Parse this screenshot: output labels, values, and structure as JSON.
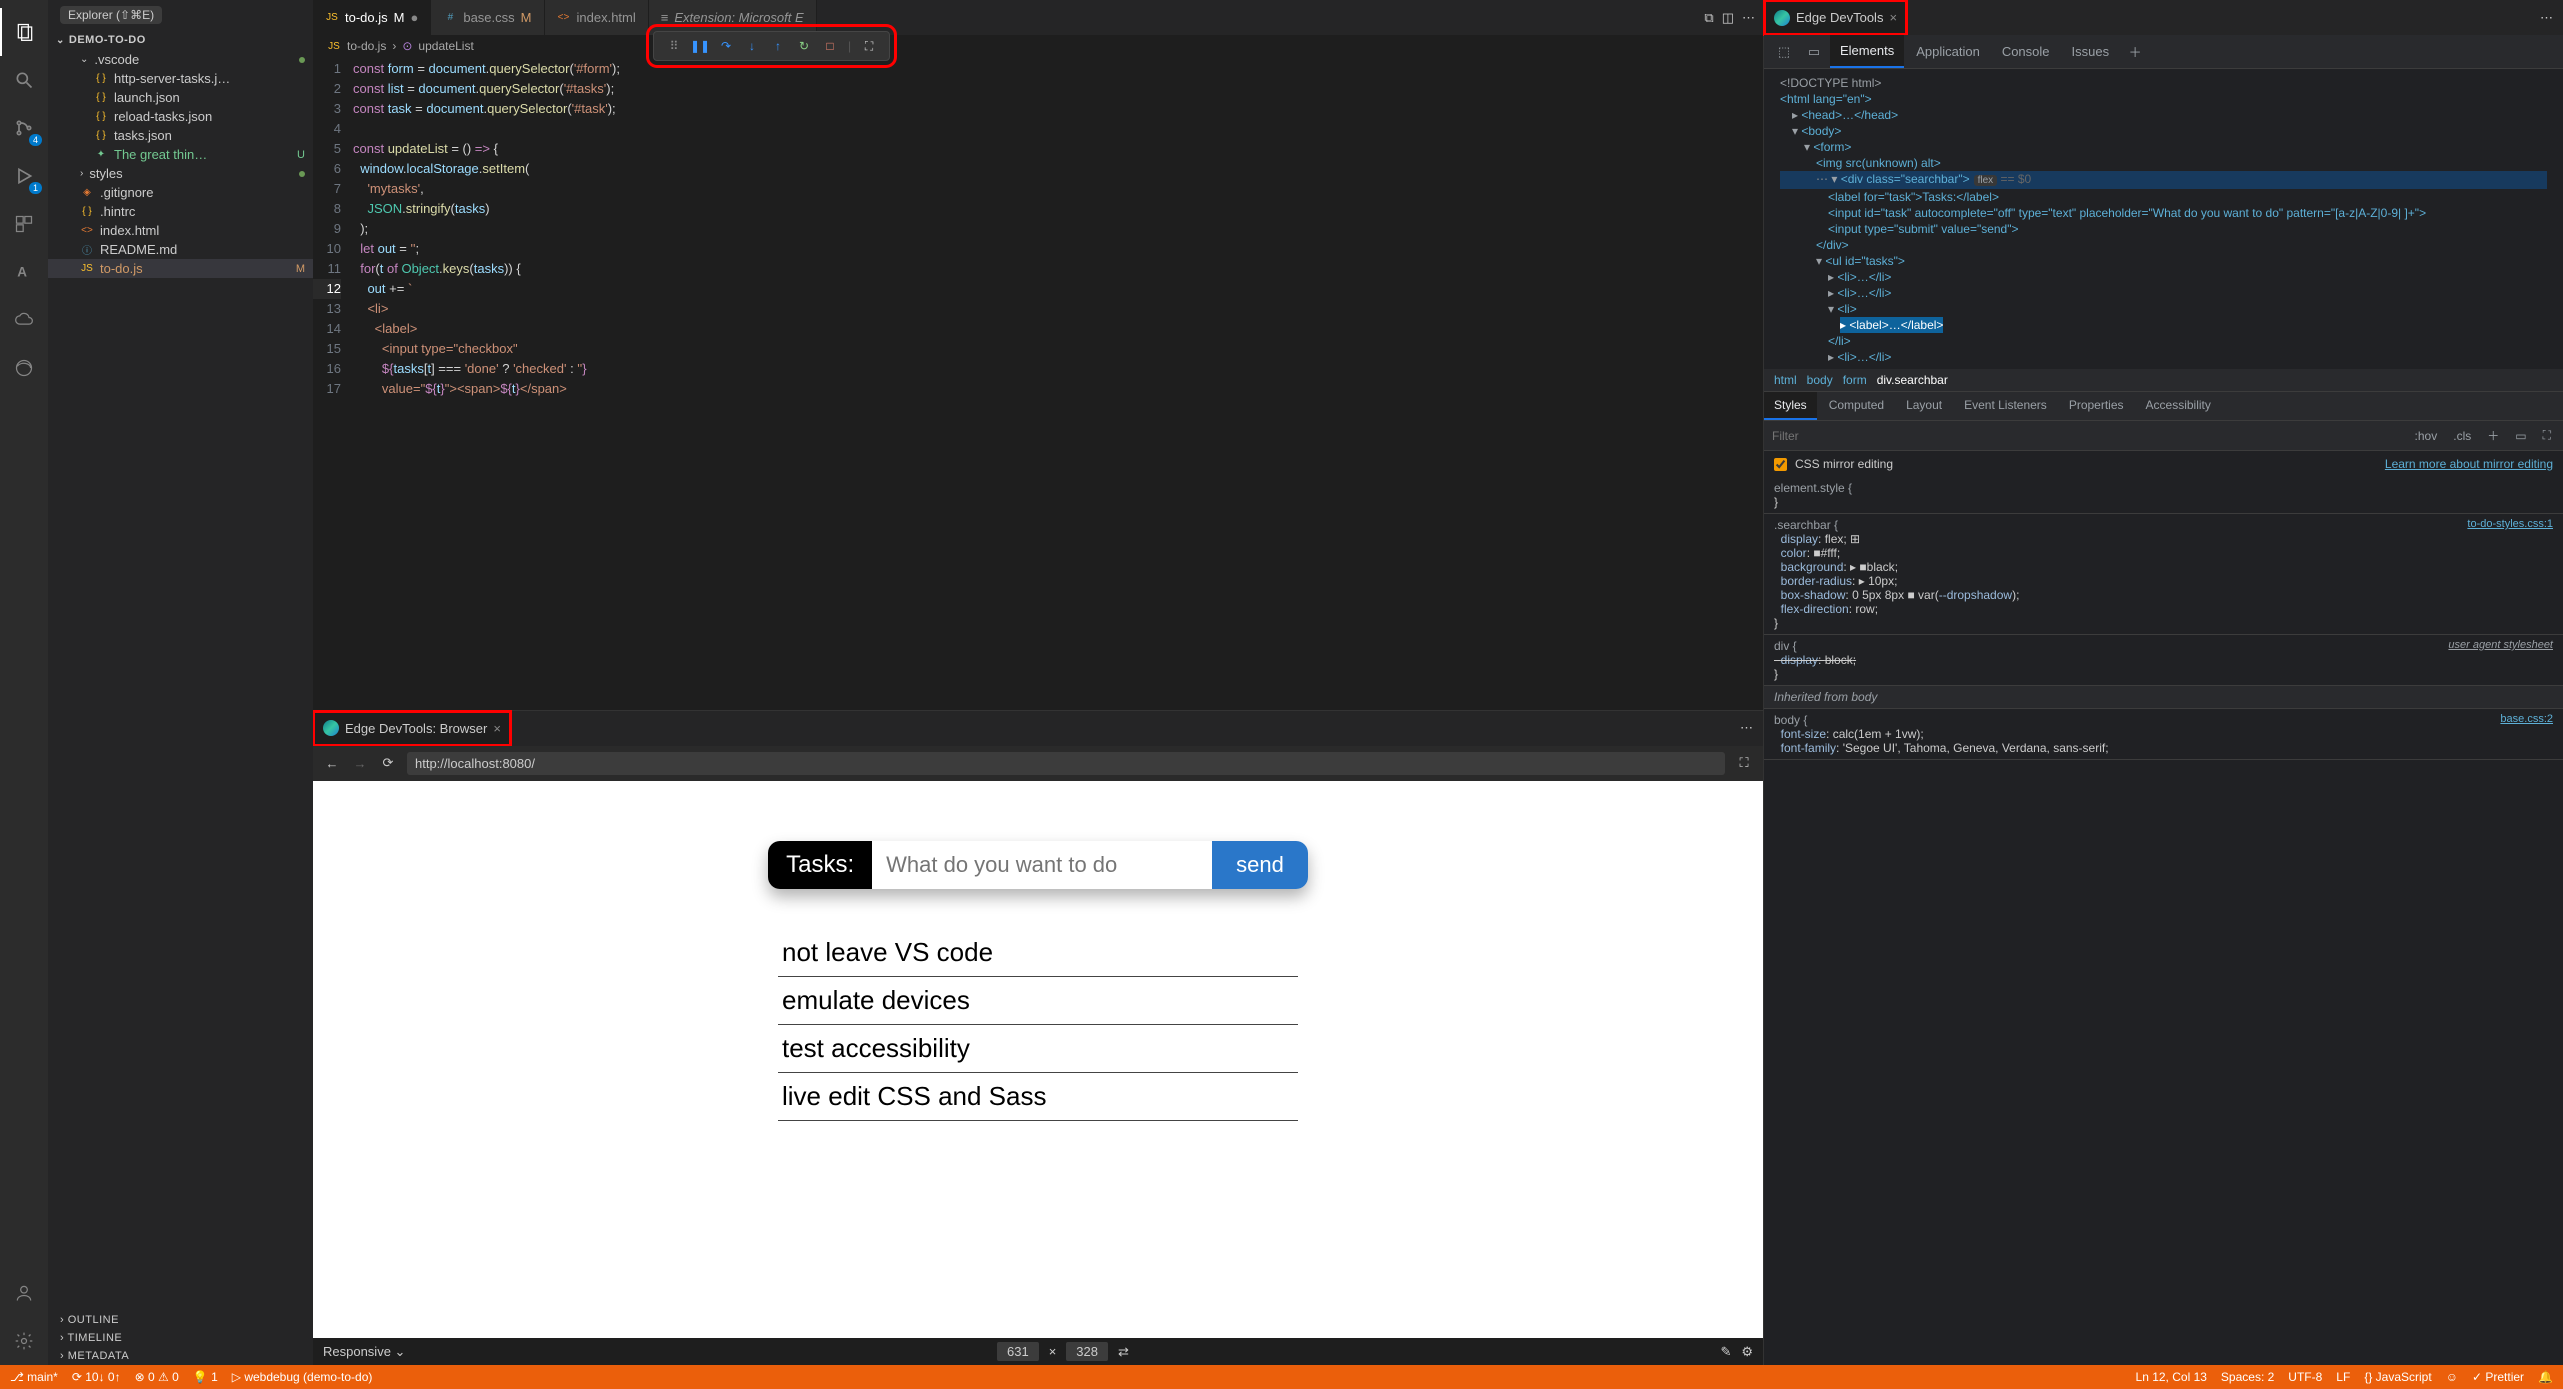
{
  "sidebar": {
    "explorer_label": "Explorer (⇧⌘E)",
    "project": "DEMO-TO-DO",
    "folder_vscode": ".vscode",
    "files": {
      "http_tasks": "http-server-tasks.j…",
      "launch": "launch.json",
      "reload": "reload-tasks.json",
      "tasks": "tasks.json",
      "great": "The great thin…",
      "styles": "styles",
      "gitignore": ".gitignore",
      "hintrc": ".hintrc",
      "index": "index.html",
      "readme": "README.md",
      "todo": "to-do.js"
    },
    "badges": {
      "great": "U",
      "todo": "M"
    },
    "outline": "OUTLINE",
    "timeline": "TIMELINE",
    "metadata": "METADATA"
  },
  "activity_badges": {
    "scm": "4",
    "debug": "1"
  },
  "tabs": {
    "todo": "to-do.js",
    "todo_mod": "M",
    "base": "base.css",
    "base_mod": "M",
    "index": "index.html",
    "ext": "Extension: Microsoft E"
  },
  "breadcrumb": {
    "file": "to-do.js",
    "symbol": "updateList"
  },
  "code": {
    "l1": "const form = document.querySelector('#form');",
    "l2": "const list = document.querySelector('#tasks');",
    "l3": "const task = document.querySelector('#task');",
    "l5a": "const updateList = () => {",
    "l6": "  window.localStorage.setItem(",
    "l7": "    'mytasks',",
    "l8": "    JSON.stringify(tasks)",
    "l9": "  );",
    "l10": "  let out = '';",
    "l11": "  for(t of Object.keys(tasks)) {",
    "l12": "    out += `",
    "l13": "    <li>",
    "l14": "      <label>",
    "l15": "        <input type=\"checkbox\"",
    "l16": "        ${tasks[t] === 'done' ? 'checked' : ''}",
    "l17": "        value=\"${t}\"><span>${t}</span>"
  },
  "lines": [
    "1",
    "2",
    "3",
    "4",
    "5",
    "6",
    "7",
    "8",
    "9",
    "10",
    "11",
    "12",
    "13",
    "14",
    "15",
    "16",
    "17"
  ],
  "browser_tab": {
    "title": "Edge DevTools: Browser"
  },
  "browser": {
    "url": "http://localhost:8080/",
    "task_label": "Tasks:",
    "placeholder": "What do you want to do",
    "send": "send",
    "items": [
      "not leave VS code",
      "emulate devices",
      "test accessibility",
      "live edit CSS and Sass"
    ]
  },
  "device_bar": {
    "mode": "Responsive",
    "w": "631",
    "h": "328"
  },
  "devtools_tab": {
    "title": "Edge DevTools"
  },
  "dt_tabs": {
    "elements": "Elements",
    "application": "Application",
    "console": "Console",
    "issues": "Issues"
  },
  "dom": {
    "doctype": "<!DOCTYPE html>",
    "html": "<html lang=\"en\">",
    "head": "<head>…</head>",
    "body": "<body>",
    "form": "<form>",
    "img": "<img src(unknown) alt>",
    "div_open": "<div class=\"searchbar\">",
    "flex_pill": "flex",
    "eq": "== $0",
    "label": "<label for=\"task\">Tasks:</label>",
    "input1": "<input id=\"task\" autocomplete=\"off\" type=\"text\" placeholder=\"What do you want to do\" pattern=\"[a-z|A-Z|0-9| ]+\">",
    "input2": "<input type=\"submit\" value=\"send\">",
    "div_close": "</div>",
    "ul": "<ul id=\"tasks\">",
    "li": "<li>…</li>",
    "li_open": "<li>",
    "label_sel": "<label>…</label>",
    "li_close": "</li>"
  },
  "dom_crumb": {
    "html": "html",
    "body": "body",
    "form": "form",
    "div": "div.searchbar"
  },
  "styles_tabs": {
    "styles": "Styles",
    "computed": "Computed",
    "layout": "Layout",
    "listeners": "Event Listeners",
    "properties": "Properties",
    "accessibility": "Accessibility"
  },
  "filter": {
    "placeholder": "Filter",
    "hov": ":hov",
    "cls": ".cls"
  },
  "mirror": {
    "label": "CSS mirror editing",
    "link": "Learn more about mirror editing"
  },
  "rules": {
    "element_style": "element.style {",
    "brace_close": "}",
    "searchbar_sel": ".searchbar {",
    "src1": "to-do-styles.css:1",
    "p1": "display: flex;",
    "p2": "color: ■#fff;",
    "p3": "background: ▶ ■black;",
    "p4": "border-radius: ▶ 10px;",
    "p5": "box-shadow: 0 5px 8px ■ var(--dropshadow);",
    "p6": "flex-direction: row;",
    "div_sel": "div {",
    "ua": "user agent stylesheet",
    "div_p": "display: block;",
    "inherited": "Inherited from body",
    "body_sel": "body {",
    "src2": "base.css:2",
    "body_p1": "font-size: calc(1em + 1vw);",
    "body_p2": "font-family: 'Segoe UI', Tahoma, Geneva, Verdana, sans-serif;"
  },
  "status": {
    "branch": "main*",
    "sync": "⟳ 10↓ 0↑",
    "errors": "⊗ 0 ⚠ 0",
    "hints": "1",
    "debug_target": "webdebug (demo-to-do)",
    "pos": "Ln 12, Col 13",
    "spaces": "Spaces: 2",
    "encoding": "UTF-8",
    "eol": "LF",
    "lang": "JavaScript",
    "prettier": "Prettier"
  }
}
